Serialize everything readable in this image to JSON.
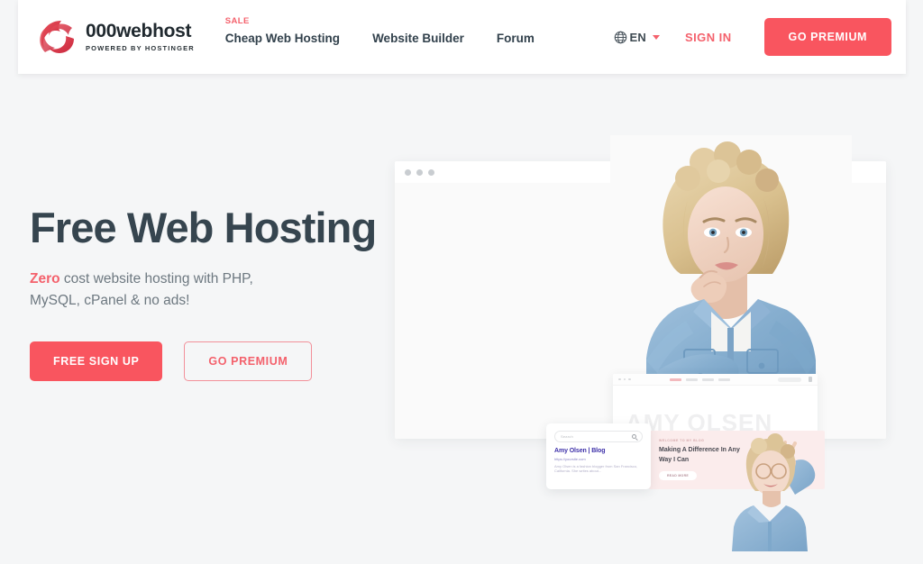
{
  "navbar": {
    "brand": {
      "name": "000webhost",
      "tagline": "POWERED BY HOSTINGER",
      "logo_icon": "swirl-logo-icon"
    },
    "links": [
      {
        "label": "Cheap Web Hosting",
        "badge": "SALE"
      },
      {
        "label": "Website Builder",
        "badge": ""
      },
      {
        "label": "Forum",
        "badge": ""
      }
    ],
    "language": {
      "icon": "globe-icon",
      "code": "EN",
      "caret_icon": "chevron-down-icon"
    },
    "sign_in": "SIGN IN",
    "go_premium": "GO PREMIUM"
  },
  "hero": {
    "title": "Free Web Hosting",
    "subtitle_accent": "Zero",
    "subtitle_rest": " cost website hosting with PHP, MySQL, cPanel & no ads!",
    "primary_cta": "FREE SIGN UP",
    "secondary_cta": "GO PREMIUM"
  },
  "artwork": {
    "main_browser": {
      "dots_count": 3
    },
    "amy_browser": {
      "site_title": "AMY OLSEN"
    },
    "search_card": {
      "search_placeholder": "Search",
      "result_title": "Amy Olsen | Blog",
      "result_url": "https://yoursite.com",
      "result_description": "Amy Olsen is a fashion blogger from San Francisco, California. She writes about..."
    },
    "promo_card": {
      "eyebrow": "WELCOME TO MY BLOG",
      "headline": "Making A Difference In Any Way I Can",
      "button": "READ MORE"
    }
  },
  "colors": {
    "brand_coral": "#f9555f",
    "accent_red": "#f4616c",
    "heading_dark": "#36454f",
    "body_gray": "#6d7880",
    "page_bg": "#f5f6f7"
  }
}
